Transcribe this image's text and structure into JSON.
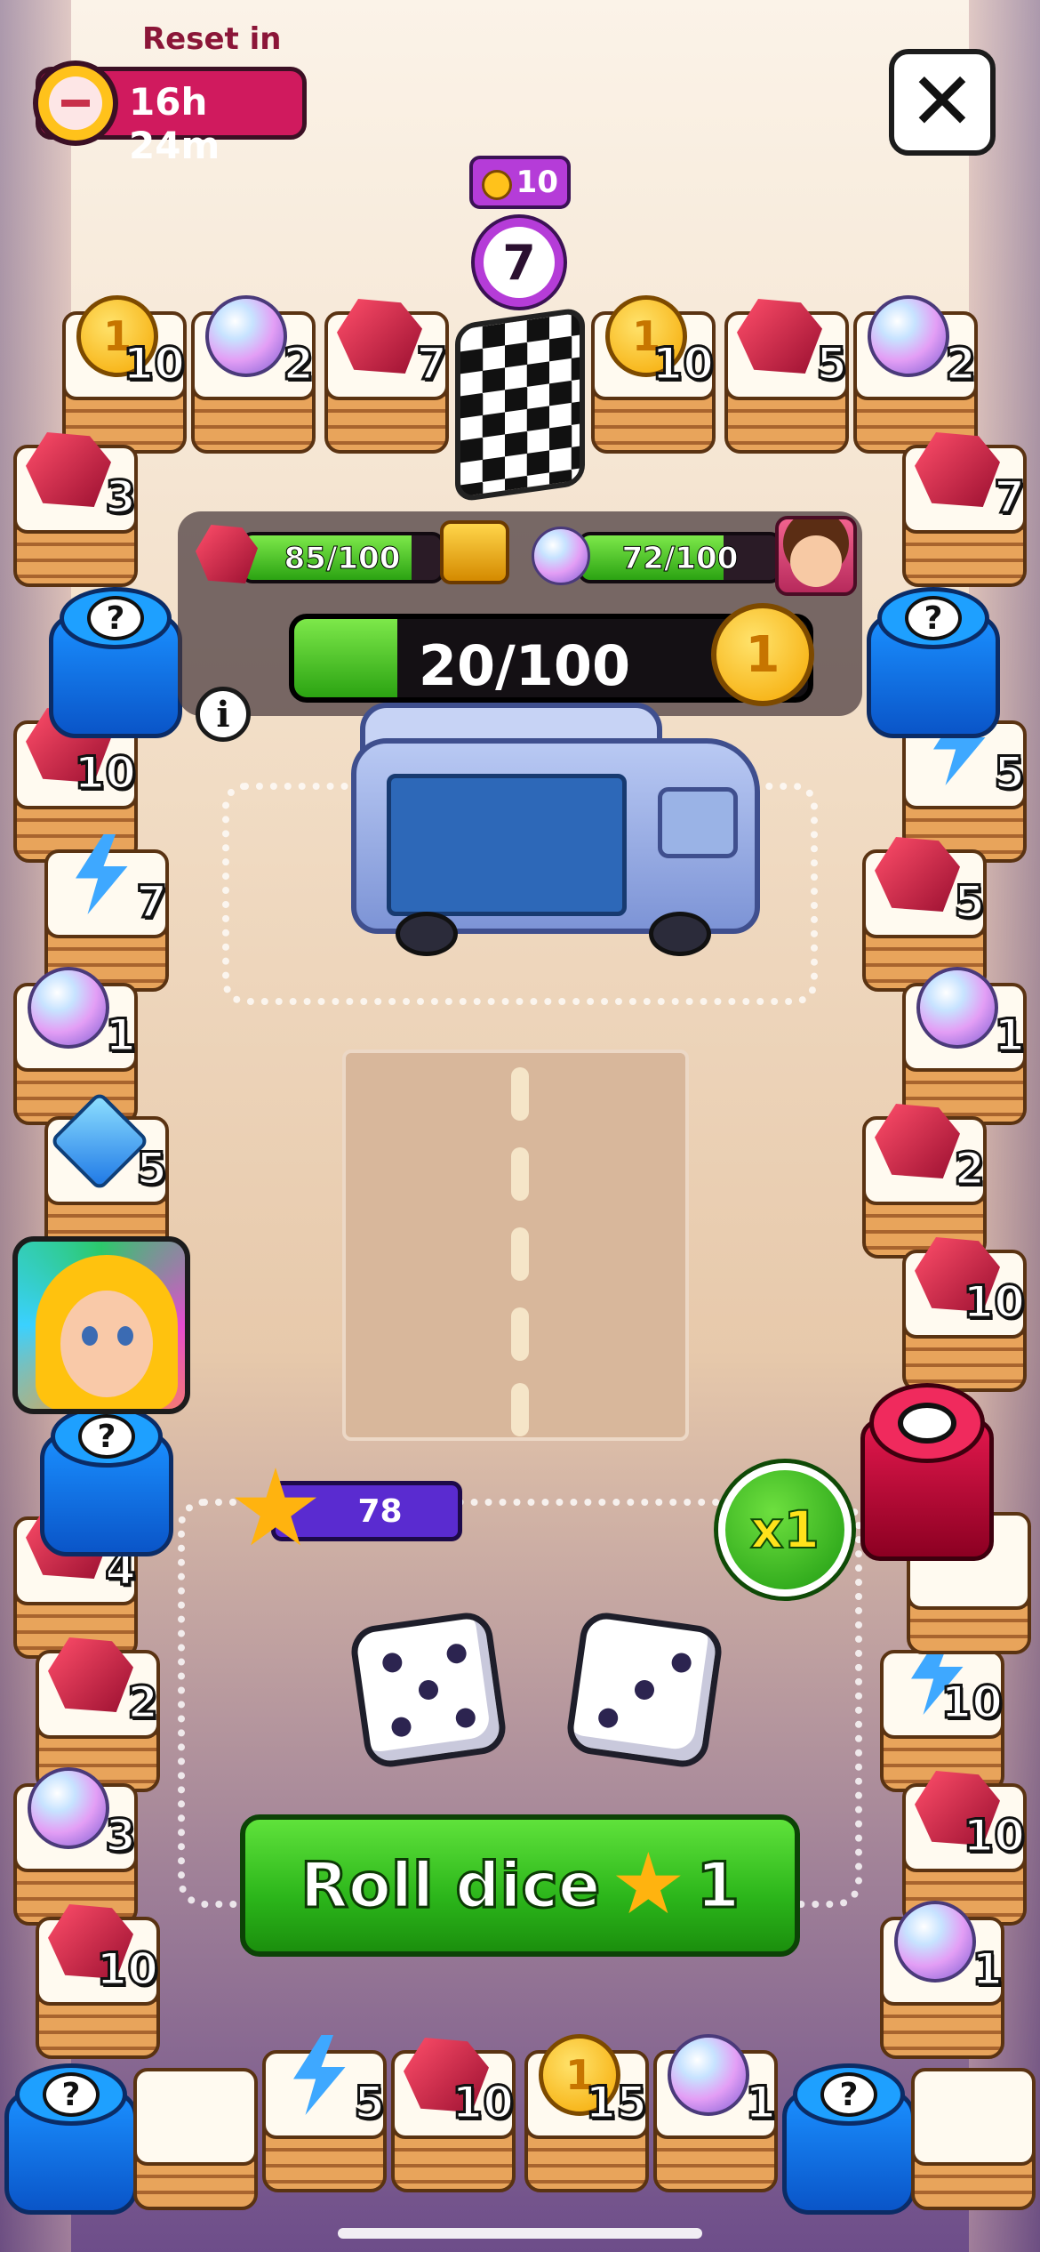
{
  "header": {
    "reset_label": "Reset in",
    "timer": "16h 24m",
    "close_label": "✕"
  },
  "top_badge": {
    "cost": "10",
    "rolls": "7"
  },
  "board": {
    "top_row": [
      {
        "type": "coin",
        "count": "10"
      },
      {
        "type": "orb",
        "count": "2"
      },
      {
        "type": "ruby",
        "count": "7"
      },
      {
        "type": "coin",
        "count": "10"
      },
      {
        "type": "ruby",
        "count": "5"
      },
      {
        "type": "orb",
        "count": "2"
      }
    ],
    "left_col": [
      {
        "type": "ruby",
        "count": "3"
      },
      {
        "type": "ruby",
        "count": "10"
      },
      {
        "type": "bolt",
        "count": "7"
      },
      {
        "type": "orb",
        "count": "1"
      },
      {
        "type": "gem",
        "count": "5"
      },
      {
        "type": "ruby",
        "count": "4"
      },
      {
        "type": "ruby",
        "count": "2"
      },
      {
        "type": "orb",
        "count": "3"
      },
      {
        "type": "ruby",
        "count": "10"
      }
    ],
    "right_col": [
      {
        "type": "ruby",
        "count": "7"
      },
      {
        "type": "bolt",
        "count": "5"
      },
      {
        "type": "ruby",
        "count": "5"
      },
      {
        "type": "orb",
        "count": "1"
      },
      {
        "type": "ruby",
        "count": "2"
      },
      {
        "type": "ruby",
        "count": "10"
      },
      {
        "type": "bolt",
        "count": "10"
      },
      {
        "type": "ruby",
        "count": "10"
      },
      {
        "type": "orb",
        "count": "1"
      }
    ],
    "bottom_row": [
      {
        "type": "bolt",
        "count": "5"
      },
      {
        "type": "ruby",
        "count": "10"
      },
      {
        "type": "coin",
        "count": "15"
      },
      {
        "type": "orb",
        "count": "1"
      }
    ],
    "question_mark": "?"
  },
  "progress": {
    "ruby_bar": "85/100",
    "ruby_fraction": 0.85,
    "orb_bar": "72/100",
    "orb_fraction": 0.72,
    "main_bar": "20/100",
    "main_fraction": 0.2,
    "info_label": "i"
  },
  "stars": {
    "count": "78"
  },
  "multiplier": {
    "label": "x1"
  },
  "dice": {
    "left_value": 5,
    "right_value": 3
  },
  "roll_button": {
    "label": "Roll dice",
    "cost": "1"
  },
  "colors": {
    "accent_green": "#2bb51a",
    "accent_purple": "#b53cd8",
    "timer_pink": "#d01a5e"
  }
}
